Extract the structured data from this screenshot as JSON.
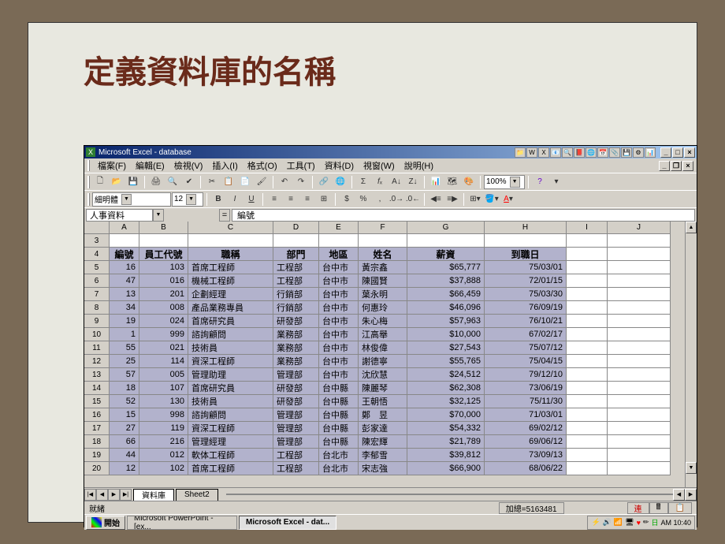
{
  "slide_title": "定義資料庫的名稱",
  "titlebar": "Microsoft Excel - database",
  "menu": [
    "檔案(F)",
    "編輯(E)",
    "檢視(V)",
    "插入(I)",
    "格式(O)",
    "工具(T)",
    "資料(D)",
    "視窗(W)",
    "說明(H)"
  ],
  "font_name": "細明體",
  "font_size": "12",
  "zoom": "100%",
  "namebox": "人事資料",
  "formula_value": "編號",
  "col_letters": [
    "A",
    "B",
    "C",
    "D",
    "E",
    "F",
    "G",
    "H",
    "I",
    "J"
  ],
  "row_nums": [
    3,
    4,
    5,
    6,
    7,
    8,
    9,
    10,
    11,
    12,
    13,
    14,
    15,
    16,
    17,
    18,
    19,
    20
  ],
  "headers": [
    "編號",
    "員工代號",
    "職稱",
    "部門",
    "地區",
    "姓名",
    "薪資",
    "到職日"
  ],
  "rows": [
    [
      "16",
      "103",
      "首席工程師",
      "工程部",
      "台中市",
      "黃宗鑫",
      "$65,777",
      "75/03/01"
    ],
    [
      "47",
      "016",
      "機械工程師",
      "工程部",
      "台中市",
      "陳國賢",
      "$37,888",
      "72/01/15"
    ],
    [
      "13",
      "201",
      "企劃經理",
      "行銷部",
      "台中市",
      "葉永明",
      "$66,459",
      "75/03/30"
    ],
    [
      "34",
      "008",
      "產品業務專員",
      "行銷部",
      "台中市",
      "何惠玲",
      "$46,096",
      "76/09/19"
    ],
    [
      "19",
      "024",
      "首席研究員",
      "研發部",
      "台中市",
      "朱心梅",
      "$57,963",
      "76/10/21"
    ],
    [
      "1",
      "999",
      "諮詢顧問",
      "業務部",
      "台中市",
      "江高舉",
      "$10,000",
      "67/02/17"
    ],
    [
      "55",
      "021",
      "技術員",
      "業務部",
      "台中市",
      "林俊偉",
      "$27,543",
      "75/07/12"
    ],
    [
      "25",
      "114",
      "資深工程師",
      "業務部",
      "台中市",
      "謝德寧",
      "$55,765",
      "75/04/15"
    ],
    [
      "57",
      "005",
      "管理助理",
      "管理部",
      "台中市",
      "沈欣慧",
      "$24,512",
      "79/12/10"
    ],
    [
      "18",
      "107",
      "首席研究員",
      "研發部",
      "台中縣",
      "陳麗琴",
      "$62,308",
      "73/06/19"
    ],
    [
      "52",
      "130",
      "技術員",
      "研發部",
      "台中縣",
      "王朝悟",
      "$32,125",
      "75/11/30"
    ],
    [
      "15",
      "998",
      "諮詢顧問",
      "管理部",
      "台中縣",
      "鄭　昱",
      "$70,000",
      "71/03/01"
    ],
    [
      "27",
      "119",
      "資深工程師",
      "管理部",
      "台中縣",
      "彭家達",
      "$54,332",
      "69/02/12"
    ],
    [
      "66",
      "216",
      "管理經理",
      "管理部",
      "台中縣",
      "陳宏輝",
      "$21,789",
      "69/06/12"
    ],
    [
      "44",
      "012",
      "軟体工程師",
      "工程部",
      "台北市",
      "李郁雪",
      "$39,812",
      "73/09/13"
    ],
    [
      "12",
      "102",
      "首席工程師",
      "工程部",
      "台北市",
      "宋志強",
      "$66,900",
      "68/06/22"
    ]
  ],
  "tabs": {
    "active": "資料庫",
    "inactive": "Sheet2"
  },
  "status_ready": "就緒",
  "status_sum": "加總=5163481",
  "taskbar": {
    "start": "開始",
    "task1": "Microsoft PowerPoint - [ex...",
    "task2": "Microsoft Excel - dat...",
    "time": "AM 10:40"
  },
  "chart_data": {
    "type": "table",
    "title": "人事資料",
    "columns": [
      "編號",
      "員工代號",
      "職稱",
      "部門",
      "地區",
      "姓名",
      "薪資",
      "到職日"
    ],
    "sum": 5163481
  }
}
